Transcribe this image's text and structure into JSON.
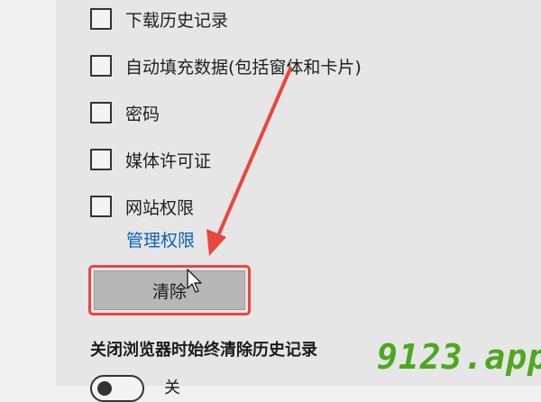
{
  "options": [
    {
      "label": "下载历史记录",
      "checked": false
    },
    {
      "label": "自动填充数据(包括窗体和卡片)",
      "checked": false
    },
    {
      "label": "密码",
      "checked": false
    },
    {
      "label": "媒体许可证",
      "checked": false
    },
    {
      "label": "网站权限",
      "checked": false
    }
  ],
  "manage_permissions_link": "管理权限",
  "clear_button_label": "清除",
  "always_clear_heading": "关闭浏览器时始终清除历史记录",
  "toggle": {
    "label": "关",
    "state": "off"
  },
  "watermark": "9123.app",
  "colors": {
    "highlight": "#e8473f",
    "link": "#0a63b6",
    "watermark": "#4da81f"
  }
}
